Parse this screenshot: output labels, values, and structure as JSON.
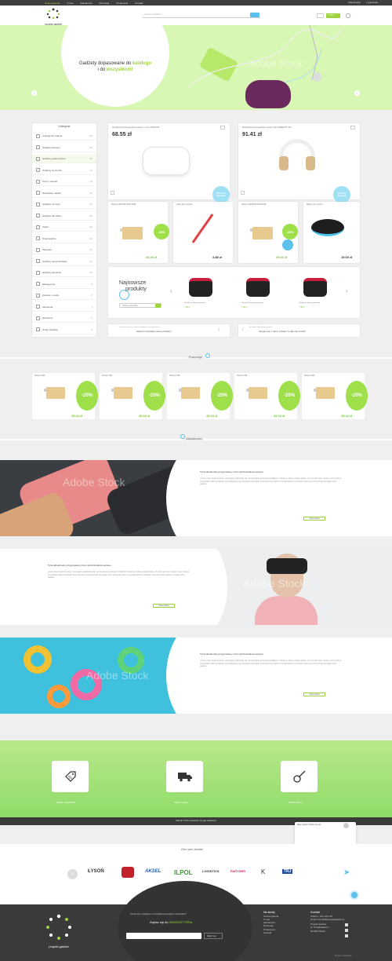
{
  "topbar": {
    "items": [
      "Strona główna",
      "O nas",
      "Aktualności",
      "Promocje",
      "Producenci",
      "Kontakt"
    ],
    "right": [
      "Rejestracja",
      "Logowanie"
    ]
  },
  "header": {
    "logo_text": "projekt gadżet",
    "search_placeholder": "Czego szukasz?",
    "cart": "0,00 zł"
  },
  "hero": {
    "line1": "Gadżety dopasowane do ",
    "line1_accent": "każdego",
    "line2": "i do ",
    "line2_accent": "wszystkich!",
    "watermark": "Adobe Stock"
  },
  "categories": {
    "title": "Kategorie",
    "items": [
      {
        "label": "Artykuły do pisania",
        "count": "123"
      },
      {
        "label": "Gadżety biurowe",
        "count": "64"
      },
      {
        "label": "Gadżety elektroniczne",
        "count": "49"
      },
      {
        "label": "Gadżety do kuchni",
        "count": "44"
      },
      {
        "label": "Torby i plecaki",
        "count": "33"
      },
      {
        "label": "Narzędzia i latarki",
        "count": "26"
      },
      {
        "label": "Gadżety na zimę",
        "count": "21"
      },
      {
        "label": "Gadżety dla dzieci",
        "count": "19"
      },
      {
        "label": "Kubki",
        "count": "18"
      },
      {
        "label": "Smartwatche",
        "count": "15"
      },
      {
        "label": "Parasole",
        "count": "12"
      },
      {
        "label": "Gadżety samochodowe",
        "count": "11"
      },
      {
        "label": "Gadżety sportowe",
        "count": "10"
      },
      {
        "label": "Ekologiczne",
        "count": "9"
      },
      {
        "label": "Zdrowie i uroda",
        "count": "8"
      },
      {
        "label": "Akcesoria",
        "count": "7"
      },
      {
        "label": "Dla dzieci",
        "count": "6"
      },
      {
        "label": "Smart Gadżety",
        "count": "5"
      }
    ]
  },
  "featured": [
    {
      "name": "Słuchawki bezprzewodowe douszne z etui LIVIDA 100",
      "price": "68.55 zł",
      "badge": "Oferta na zapytanie"
    },
    {
      "name": "Słuchawki bezprzewodowe nauszne PLAYDEEP BT 100",
      "price": "91.41 zł",
      "badge": "Oferta na zapytanie"
    }
  ],
  "products": [
    {
      "name": "Pamięć USB 8GB 16GB 32GB",
      "price": "49,34 zł",
      "badge": "-20%"
    },
    {
      "name": "Selfie stick z pilotem",
      "price": "4.88 zł"
    },
    {
      "name": "Pamięć USB 8GB 16GB 32GB",
      "price": "49,34 zł",
      "badge": "-20%"
    },
    {
      "name": "Piłka do gry w domu",
      "price": "19.60 zł"
    }
  ],
  "newest": {
    "title1": "Najnowsze",
    "title2": "produkty",
    "button": "Zobacz wszystkie",
    "items": [
      {
        "name": "Uchwyt na telefon gamepad",
        "price": "7.48 zł"
      },
      {
        "name": "Uchwyt na telefon gamepad",
        "price": "7.48 zł"
      },
      {
        "name": "Uchwyt na telefon gamepad",
        "price": "7.48 zł"
      }
    ]
  },
  "banners": [
    {
      "small": "Jesteś hurtownią, szukasz gadżetów na zamówienie?",
      "big": "Zobacz wszystkie nowe produkty!"
    },
    {
      "small": "Nie wiesz który gadżet wybrać?",
      "big": "Skojarz się z nami, zobacz co dla nas zrobić!"
    }
  ],
  "promotions": {
    "title": "Promocje",
    "items": [
      {
        "name": "Pamięć USB",
        "price": "49,34 zł",
        "badge": "-20%"
      },
      {
        "name": "Pamięć USB",
        "price": "49,34 zł",
        "badge": "-20%"
      },
      {
        "name": "Pamięć USB",
        "price": "49,34 zł",
        "badge": "-20%"
      },
      {
        "name": "Pamięć USB",
        "price": "49,34 zł",
        "badge": "-20%"
      },
      {
        "name": "Pamięć USB",
        "price": "49,34 zł",
        "badge": "-20%"
      }
    ]
  },
  "news": {
    "title": "Aktualności",
    "items": [
      {
        "title": "Tytuł aktualności przygotowany przez administratora serwisu",
        "body": "Lorem ipsum dolor sit amet, consectetur adipiscing elit, sed do eiusmod tempor incididunt ut labore et dolore magna aliqua. Ut enim ad minim veniam, quis nostrud exercitation ullamco laboris nisi ut aliquip ex ea commodo consequat. Duis aute irure dolor in reprehenderit in voluptate velit esse cillum dolore eu fugiat nulla pariatur.",
        "button": "więcej dalej",
        "watermark": "Adobe Stock"
      },
      {
        "title": "Tytuł aktualności przygotowany przez administratora serwisu",
        "body": "Lorem ipsum dolor sit amet, consectetur adipiscing elit, sed do eiusmod tempor incididunt ut labore et dolore magna aliqua. Ut enim ad minim veniam, quis nostrud exercitation ullamco laboris nisi ut aliquip ex ea commodo consequat. Duis aute irure dolor in reprehenderit in voluptate velit esse cillum dolore eu fugiat nulla pariatur.",
        "button": "więcej dalej",
        "watermark": "Adobe Stock"
      },
      {
        "title": "Tytuł aktualności przygotowany przez administratora serwisu",
        "body": "Lorem ipsum dolor sit amet, consectetur adipiscing elit, sed do eiusmod tempor incididunt ut labore et dolore magna aliqua. Ut enim ad minim veniam, quis nostrud exercitation ullamco laboris nisi ut aliquip ex ea commodo consequat. Duis aute irure dolor in reprehenderit in voluptate velit esse cillum dolore eu fugiat nulla pariatur.",
        "button": "więcej dalej",
        "watermark": "Adobe Stock"
      }
    ]
  },
  "features": [
    {
      "label": "Nadruk na gadżetach"
    },
    {
      "label": "Szybka wysyłka"
    },
    {
      "label": "Gadżety dla firm"
    }
  ],
  "darkstrip": "Kliknij TUTAJ dowiedz się jak działamy",
  "chat": "Masz pytanie? Napisz do nas",
  "partners": {
    "title": "Oni nam zaufali",
    "logos": [
      "ŁYSOŃ",
      "",
      "AKSEL",
      "ILPOL",
      "LOGISTICS",
      "PARTNER",
      "",
      "TRJ"
    ]
  },
  "footer": {
    "newsletter_q": "Chcesz być na bieżąco ze wszystkimi promocjami i nowościami?",
    "newsletter_title": "Zapisz się do ",
    "newsletter_accent": "NEWSLETTERa",
    "newsletter_btn": "Zapisz się",
    "nav_title": "Na skróty",
    "nav": [
      "Strona główna",
      "O nas",
      "Aktualności",
      "Promocje",
      "Producenci",
      "Kontakt"
    ],
    "contact_title": "Kontakt",
    "contact": [
      "Telefon: 123 123 123",
      "Email: kontakt@projektgadzet.pl",
      "Projekt Gadżet",
      "ul. Przykładowa 1",
      "00-000 Miasto"
    ],
    "credit": "Projekt i wykonanie: "
  },
  "colors": {
    "accent": "#9fd33e",
    "blue": "#5bc0eb",
    "dark": "#3a3a3a"
  }
}
